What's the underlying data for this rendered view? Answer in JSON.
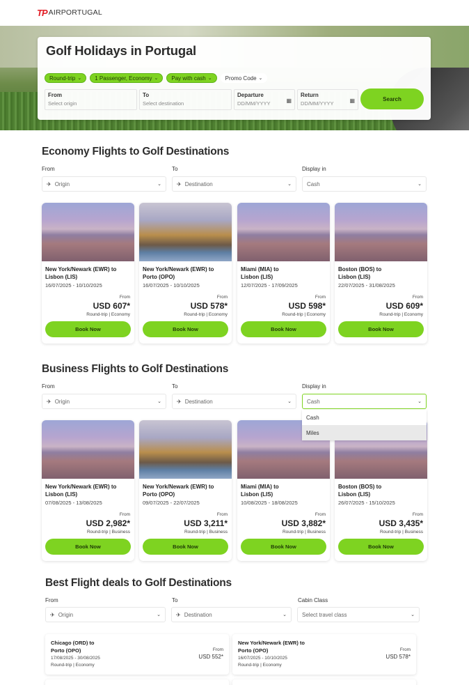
{
  "brand": {
    "tp": "TP",
    "name": "AIRPORTUGAL"
  },
  "hero": {
    "title": "Golf Holidays in Portugal",
    "chips": [
      "Round-trip",
      "1 Passenger, Economy",
      "Pay with cash"
    ],
    "promo": "Promo Code",
    "fields": {
      "from_label": "From",
      "from_ph": "Select origin",
      "to_label": "To",
      "to_ph": "Select destination",
      "dep_label": "Departure",
      "dep_ph": "DD/MM/YYYY",
      "ret_label": "Return",
      "ret_ph": "DD/MM/YYYY"
    },
    "search_label": "Search"
  },
  "economy": {
    "title": "Economy Flights to Golf Destinations",
    "labels": {
      "from": "From",
      "to": "To",
      "display": "Display in"
    },
    "selects": {
      "origin": "Origin",
      "destination": "Destination",
      "display": "Cash"
    },
    "cards": [
      {
        "route1": "New York/Newark (EWR) to",
        "route2": "Lisbon (LIS)",
        "dates": "16/07/2025 - 10/10/2025",
        "from": "From",
        "price": "USD 607*",
        "meta": "Round-trip | Economy",
        "book": "Book Now"
      },
      {
        "route1": "New York/Newark (EWR) to",
        "route2": "Porto (OPO)",
        "dates": "16/07/2025 - 10/10/2025",
        "from": "From",
        "price": "USD 578*",
        "meta": "Round-trip | Economy",
        "book": "Book Now"
      },
      {
        "route1": "Miami (MIA) to",
        "route2": "Lisbon (LIS)",
        "dates": "12/07/2025 - 17/09/2025",
        "from": "From",
        "price": "USD 598*",
        "meta": "Round-trip | Economy",
        "book": "Book Now"
      },
      {
        "route1": "Boston (BOS) to",
        "route2": "Lisbon (LIS)",
        "dates": "22/07/2025 - 31/08/2025",
        "from": "From",
        "price": "USD 609*",
        "meta": "Round-trip | Economy",
        "book": "Book Now"
      }
    ]
  },
  "business": {
    "title": "Business Flights to Golf Destinations",
    "labels": {
      "from": "From",
      "to": "To",
      "display": "Display in"
    },
    "selects": {
      "origin": "Origin",
      "destination": "Destination",
      "display": "Cash"
    },
    "dropdown": [
      "Cash",
      "Miles"
    ],
    "cards": [
      {
        "route1": "New York/Newark (EWR) to",
        "route2": "Lisbon (LIS)",
        "dates": "07/08/2025 - 13/08/2025",
        "from": "From",
        "price": "USD 2,982*",
        "meta": "Round-trip | Business",
        "book": "Book Now"
      },
      {
        "route1": "New York/Newark (EWR) to",
        "route2": "Porto (OPO)",
        "dates": "09/07/2025 - 22/07/2025",
        "from": "From",
        "price": "USD 3,211*",
        "meta": "Round-trip | Business",
        "book": "Book Now"
      },
      {
        "route1": "Miami (MIA) to",
        "route2": "Lisbon (LIS)",
        "dates": "10/08/2025 - 18/08/2025",
        "from": "From",
        "price": "USD 3,882*",
        "meta": "Round-trip | Business",
        "book": "Book Now"
      },
      {
        "route1": "Boston (BOS) to",
        "route2": "Lisbon (LIS)",
        "dates": "26/07/2025 - 15/10/2025",
        "from": "From",
        "price": "USD 3,435*",
        "meta": "Round-trip | Business",
        "book": "Book Now"
      }
    ]
  },
  "deals": {
    "title": "Best Flight deals to Golf Destinations",
    "labels": {
      "from": "From",
      "to": "To",
      "cabin": "Cabin Class"
    },
    "selects": {
      "origin": "Origin",
      "destination": "Destination",
      "cabin": "Select travel class"
    },
    "items": [
      {
        "route1": "Chicago (ORD) to",
        "route2": "Porto (OPO)",
        "dates": "17/08/2025 - 30/08/2025",
        "meta": "Round-trip | Economy",
        "from": "From",
        "price": "USD 552*"
      },
      {
        "route1": "New York/Newark (EWR) to",
        "route2": "Porto (OPO)",
        "dates": "16/07/2025 - 10/10/2025",
        "meta": "Round-trip | Economy",
        "from": "From",
        "price": "USD 578*"
      }
    ]
  },
  "icons": {
    "plane_depart": "plane-departure-icon",
    "plane_arrive": "plane-arrival-icon",
    "calendar": "calendar-icon",
    "chevron": "chevron-down-icon"
  },
  "colors": {
    "accent": "#7ed321",
    "brand_red": "#e21e26"
  }
}
